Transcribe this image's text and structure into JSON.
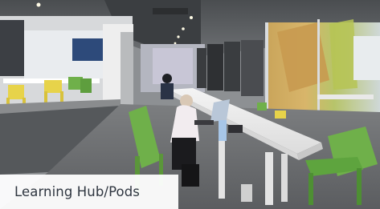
{
  "photo": {
    "subject": "Study area with long white desks, green chairs and students working on laptops"
  },
  "caption": {
    "text": "Learning Hub/Pods"
  },
  "colors": {
    "caption_background": "#ffffff",
    "caption_text": "#2f3640",
    "chair_green": "#6fb04a",
    "chair_yellow": "#e7d34a",
    "desk_white": "#f2f2f2"
  }
}
